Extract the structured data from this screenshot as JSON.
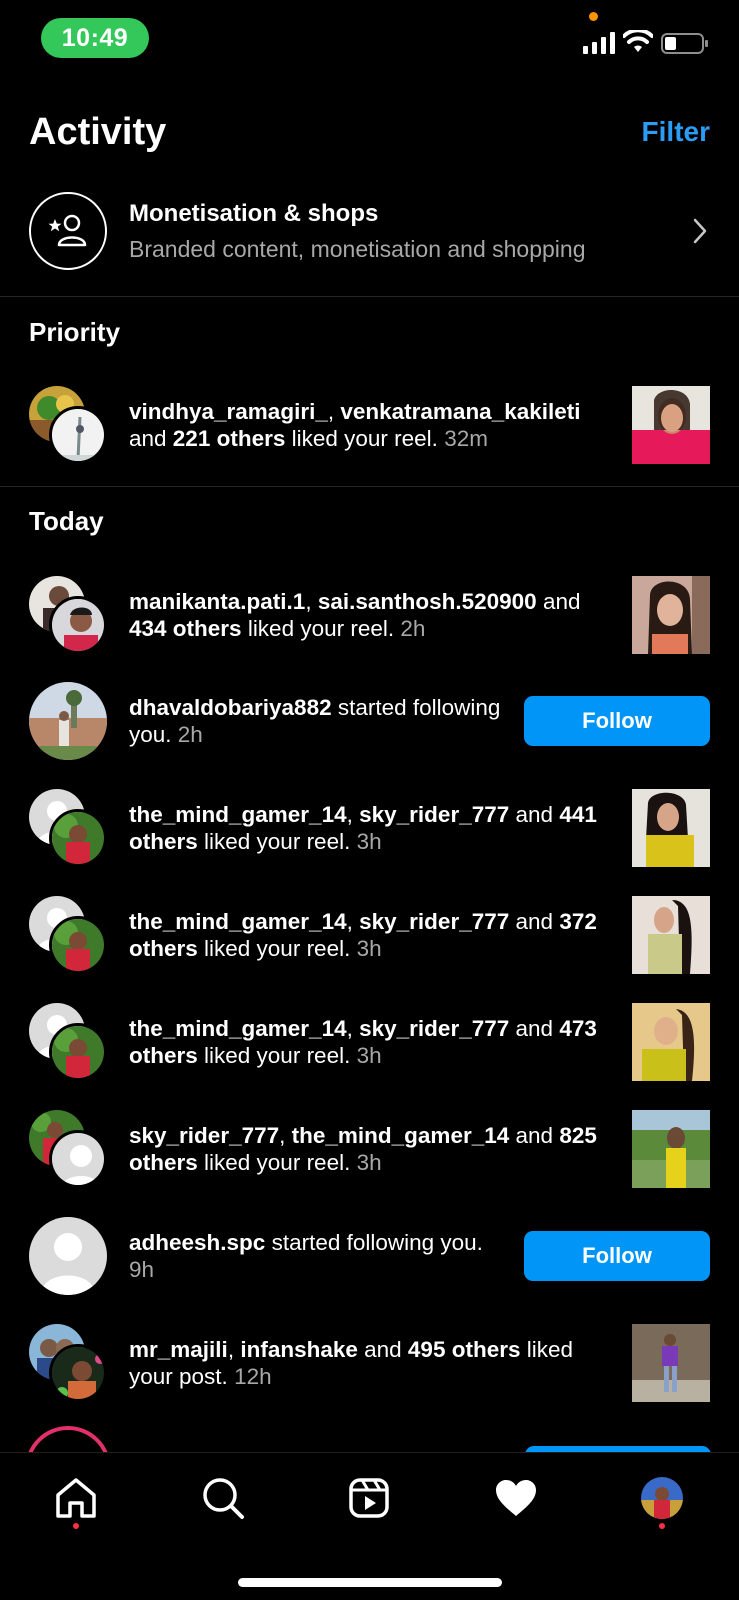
{
  "status_bar": {
    "time": "10:49"
  },
  "header": {
    "title": "Activity",
    "filter_label": "Filter"
  },
  "monetisation": {
    "title": "Monetisation & shops",
    "subtitle": "Branded content, monetisation and shopping"
  },
  "sections": {
    "priority": "Priority",
    "today": "Today"
  },
  "priority_items": [
    {
      "bold1": "vindhya_ramagiri_",
      "sep1": ", ",
      "bold2": "venkatramana_kakileti",
      "pre": " and ",
      "bold3": "221 others",
      "post": " liked your reel. ",
      "time": "32m"
    }
  ],
  "today_items": [
    {
      "bold1": "manikanta.pati.1",
      "sep1": ", ",
      "bold2": "sai.santhosh.520900",
      "pre": " and ",
      "bold3": "434 others",
      "post": " liked your reel. ",
      "time": "2h"
    },
    {
      "bold1": "dhavaldobariya882",
      "post": " started following you. ",
      "time": "2h",
      "button": "Follow"
    },
    {
      "bold1": "the_mind_gamer_14",
      "sep1": ", ",
      "bold2": "sky_rider_777",
      "pre": " and ",
      "bold3": "441 others",
      "post": " liked your reel. ",
      "time": "3h"
    },
    {
      "bold1": "the_mind_gamer_14",
      "sep1": ", ",
      "bold2": "sky_rider_777",
      "pre": " and ",
      "bold3": "372 others",
      "post": " liked your reel. ",
      "time": "3h"
    },
    {
      "bold1": "the_mind_gamer_14",
      "sep1": ", ",
      "bold2": "sky_rider_777",
      "pre": " and ",
      "bold3": "473 others",
      "post": " liked your reel. ",
      "time": "3h"
    },
    {
      "bold1": "sky_rider_777",
      "sep1": ", ",
      "bold2": "the_mind_gamer_14",
      "pre": " and ",
      "bold3": "825 others",
      "post": " liked your reel. ",
      "time": "3h"
    },
    {
      "bold1": "adheesh.spc",
      "post": " started following you. ",
      "time": "9h",
      "button": "Follow"
    },
    {
      "bold1": "mr_majili",
      "sep1": ", ",
      "bold2": "infanshake",
      "pre": " and ",
      "bold3": "495 others",
      "post": " liked your post. ",
      "time": "12h"
    }
  ],
  "nav": {
    "icons": [
      "home-icon",
      "search-icon",
      "reels-icon",
      "heart-icon",
      "profile-avatar"
    ]
  },
  "colors": {
    "accent_blue": "#0095f6",
    "filter_blue": "#2b9df4",
    "time_pill": "#34c759",
    "notification_dot": "#ff3040"
  }
}
